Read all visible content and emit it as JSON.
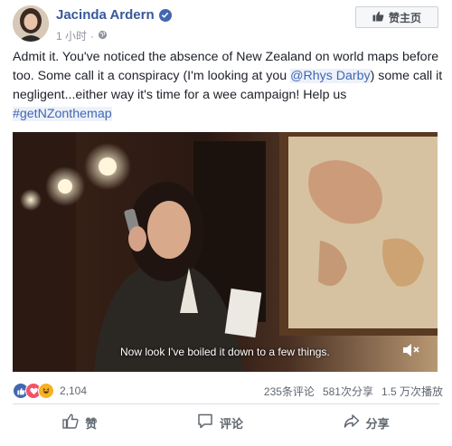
{
  "post": {
    "author": "Jacinda Ardern",
    "time": "1 小时",
    "privacy_icon": "globe-icon",
    "like_page_label": "赞主页",
    "text_parts": {
      "line1": "Admit it. You've noticed the absence of New Zealand on world maps before too. Some call it a conspiracy (I'm looking at you ",
      "mention": "@Rhys Darby",
      "line2": ") some call it negligent...either way it's time for a wee campaign! Help us ",
      "hashtag": "#getNZonthemap"
    }
  },
  "video": {
    "caption": "Now look I've boiled it down to a few things."
  },
  "engagement": {
    "reaction_count": "2,104",
    "comments": "235条评论",
    "shares": "581次分享",
    "views": "1.5 万次播放"
  },
  "actions": {
    "like": "赞",
    "comment": "评论",
    "share": "分享"
  },
  "colors": {
    "link": "#385898",
    "like_blue": "#4267b2",
    "love_red": "#f25268",
    "haha_yellow": "#f7b125"
  }
}
